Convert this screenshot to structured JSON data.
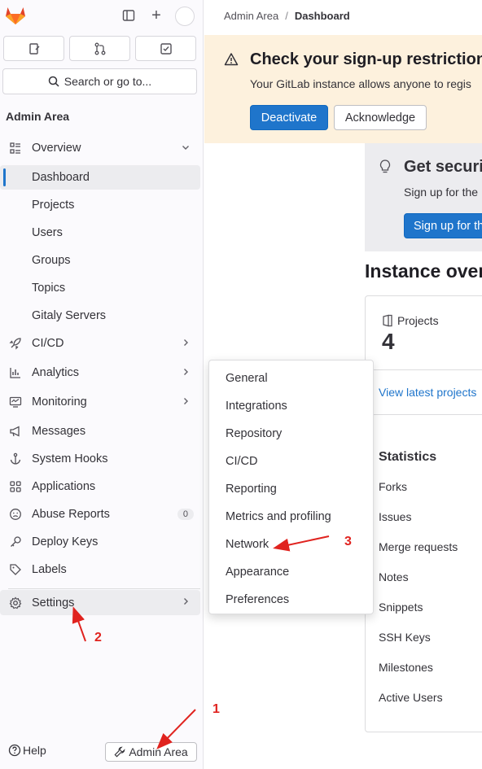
{
  "sidebar": {
    "section_title": "Admin Area",
    "search_placeholder": "Search or go to...",
    "items": [
      {
        "label": "Overview",
        "icon": "overview-icon",
        "chevron": "⌄"
      },
      {
        "label": "Dashboard",
        "active": true
      },
      {
        "label": "Projects"
      },
      {
        "label": "Users"
      },
      {
        "label": "Groups"
      },
      {
        "label": "Topics"
      },
      {
        "label": "Gitaly Servers"
      },
      {
        "label": "CI/CD",
        "icon": "rocket-icon",
        "chevron": "›"
      },
      {
        "label": "Analytics",
        "icon": "chart-icon",
        "chevron": "›"
      },
      {
        "label": "Monitoring",
        "icon": "monitor-icon",
        "chevron": "›"
      },
      {
        "label": "Messages",
        "icon": "megaphone-icon"
      },
      {
        "label": "System Hooks",
        "icon": "anchor-icon"
      },
      {
        "label": "Applications",
        "icon": "grid-icon"
      },
      {
        "label": "Abuse Reports",
        "icon": "abuse-icon",
        "badge": "0"
      },
      {
        "label": "Deploy Keys",
        "icon": "key-icon"
      },
      {
        "label": "Labels",
        "icon": "label-icon"
      },
      {
        "label": "Settings",
        "icon": "gear-icon",
        "chevron": "›"
      }
    ],
    "help_label": "Help",
    "admin_area_button": "Admin Area"
  },
  "breadcrumb": {
    "parent": "Admin Area",
    "current": "Dashboard"
  },
  "alert": {
    "title": "Check your sign-up restriction",
    "text": "Your GitLab instance allows anyone to regis",
    "deactivate_label": "Deactivate",
    "acknowledge_label": "Acknowledge"
  },
  "promo": {
    "title": "Get securi",
    "text": "Sign up for the",
    "button_label": "Sign up for th"
  },
  "overview": {
    "title": "Instance over",
    "projects_label": "Projects",
    "projects_count": "4",
    "view_link": "View latest projects",
    "statistics_title": "Statistics",
    "stats": [
      "Forks",
      "Issues",
      "Merge requests",
      "Notes",
      "Snippets",
      "SSH Keys",
      "Milestones",
      "Active Users"
    ]
  },
  "settings_menu": {
    "items": [
      "General",
      "Integrations",
      "Repository",
      "CI/CD",
      "Reporting",
      "Metrics and profiling",
      "Network",
      "Appearance",
      "Preferences"
    ]
  },
  "annotations": {
    "step1": "1",
    "step2": "2",
    "step3": "3",
    "color": "#e0231f"
  },
  "colors": {
    "accent": "#1f75cb",
    "alert_bg": "#fdf1dd",
    "sidebar_bg": "#fbfafd",
    "logo": "#e24329"
  }
}
